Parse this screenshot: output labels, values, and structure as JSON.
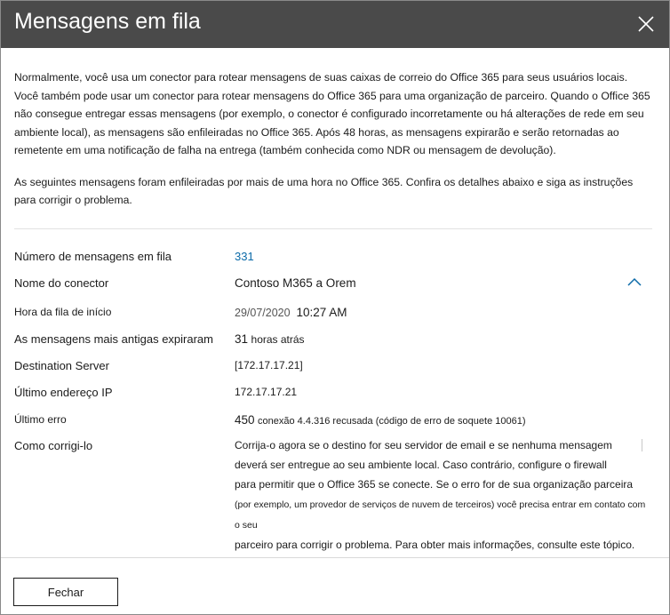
{
  "dialog": {
    "title": "Mensagens em fila",
    "close_icon": "close-icon"
  },
  "intro": {
    "paragraph1": "Normalmente, você usa um conector para rotear mensagens de suas caixas de correio do Office 365 para seus usuários locais. Você também pode usar um conector para rotear mensagens do Office 365 para uma organização de parceiro. Quando o Office 365 não consegue entregar essas mensagens (por exemplo, o conector é configurado incorretamente ou há alterações de rede em seu ambiente local), as mensagens são enfileiradas no Office 365. Após 48 horas, as mensagens expirarão e serão retornadas ao remetente em uma notificação de falha na entrega (também conhecida como NDR ou mensagem de devolução).",
    "paragraph2": "As seguintes mensagens foram enfileiradas por mais de uma hora no Office 365. Confira os detalhes abaixo e siga as instruções para corrigir o problema."
  },
  "details": {
    "queued_count": {
      "label": "Número de mensagens em fila",
      "value": "331"
    },
    "connector_name": {
      "label": "Nome do conector",
      "value": "Contoso M365 a Orem"
    },
    "queue_start": {
      "label": "Hora da fila de início",
      "date": "29/07/2020",
      "time": "10:27 AM"
    },
    "oldest_expire": {
      "label": "As mensagens mais antigas expiraram",
      "number": "31",
      "unit": "horas atrás"
    },
    "destination_server": {
      "label": "Destination Server",
      "value": "[172.17.17.21]"
    },
    "last_ip": {
      "label": "Último endereço IP",
      "value": "172.17.17.21"
    },
    "last_error": {
      "label": "Último erro",
      "code": "450",
      "text": "conexão 4.4.316 recusada (código de erro de soquete 10061)"
    },
    "how_to_fix": {
      "label": "Como corrigi-lo",
      "line1": "Corrija-o agora se o destino for seu servidor de email e se nenhuma mensagem",
      "line2": "deverá ser entregue ao seu ambiente local. Caso contrário, configure o firewall",
      "line3": "para permitir que o Office 365 se conecte. Se o erro for de sua organização parceira",
      "line4a": "(por exemplo, um provedor de serviços de nuvem de terceiros)",
      "line4b": " você precisa entrar em contato com o seu",
      "line5": "parceiro para corrigir o problema. Para obter mais informações, consulte este tópico."
    }
  },
  "footer": {
    "close_button": "Fechar"
  }
}
